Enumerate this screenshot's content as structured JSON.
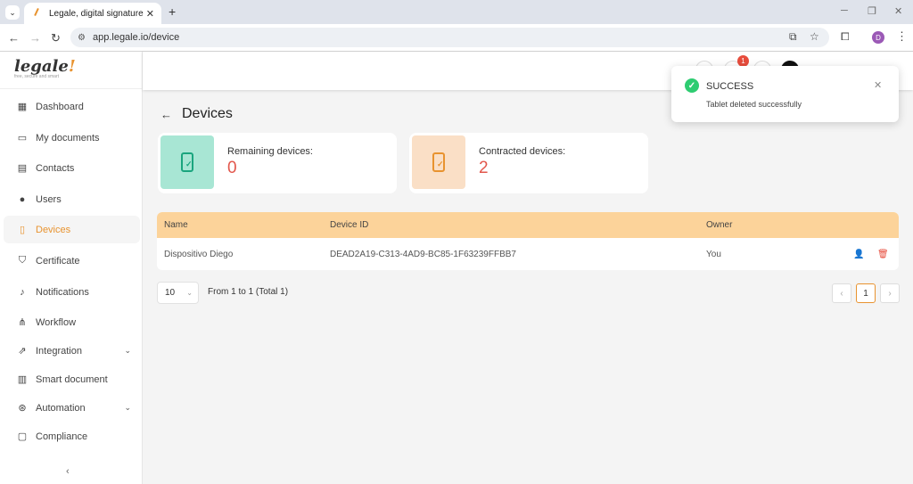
{
  "browser": {
    "tab_title": "Legale, digital signature",
    "url": "app.legale.io/device",
    "profile_initial": "D"
  },
  "logo": {
    "wordmark": "legale",
    "mark": "!",
    "tagline": "free, secure and smart"
  },
  "sidebar": {
    "items": [
      {
        "label": "Dashboard",
        "icon": "dashboard-icon"
      },
      {
        "label": "My documents",
        "icon": "folder-icon"
      },
      {
        "label": "Contacts",
        "icon": "contacts-icon"
      },
      {
        "label": "Users",
        "icon": "user-icon"
      },
      {
        "label": "Devices",
        "icon": "tablet-icon",
        "active": true
      },
      {
        "label": "Certificate",
        "icon": "shield-icon"
      },
      {
        "label": "Notifications",
        "icon": "bell-icon"
      },
      {
        "label": "Workflow",
        "icon": "workflow-icon"
      },
      {
        "label": "Integration",
        "icon": "external-link-icon",
        "expandable": true
      },
      {
        "label": "Smart document",
        "icon": "smart-document-icon"
      },
      {
        "label": "Automation",
        "icon": "automation-icon",
        "expandable": true
      },
      {
        "label": "Compliance",
        "icon": "chat-icon"
      }
    ],
    "collapse_icon": "chevron-left-icon"
  },
  "header": {
    "notification_count": "1"
  },
  "page": {
    "title": "Devices"
  },
  "stats": {
    "remaining": {
      "label": "Remaining devices:",
      "value": "0"
    },
    "contracted": {
      "label": "Contracted devices:",
      "value": "2"
    }
  },
  "table": {
    "columns": [
      "Name",
      "Device ID",
      "Owner"
    ],
    "rows": [
      {
        "name": "Dispositivo Diego",
        "device_id": "DEAD2A19-C313-4AD9-BC85-1F63239FFBB7",
        "owner": "You"
      }
    ]
  },
  "pagination": {
    "page_size": "10",
    "range_text": "From 1 to 1 (Total 1)",
    "current_page": "1"
  },
  "toast": {
    "title": "SUCCESS",
    "message": "Tablet deleted successfully"
  },
  "colors": {
    "accent": "#e8932f",
    "table_header": "#fcd39a",
    "stat_value": "#e2574c",
    "success": "#2ecc71"
  }
}
